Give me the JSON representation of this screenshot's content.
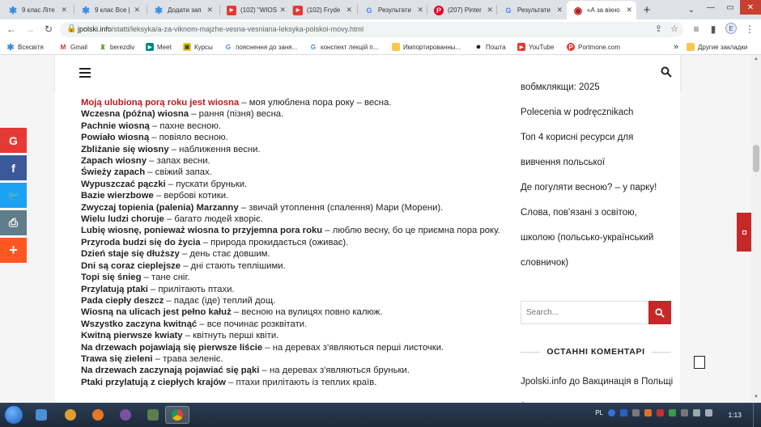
{
  "tabs": [
    {
      "label": "9 клас Літе",
      "icon": "✱",
      "color": "#3a8de0",
      "active": false
    },
    {
      "label": "9 клас Все |",
      "icon": "✱",
      "color": "#3a8de0",
      "active": false
    },
    {
      "label": "Додати зап",
      "icon": "✱",
      "color": "#3a8de0",
      "active": false
    },
    {
      "label": "(102) \"WIOS",
      "icon": "▶",
      "color": "#e53935",
      "active": false
    },
    {
      "label": "(102) Fryde",
      "icon": "▶",
      "color": "#e53935",
      "active": false
    },
    {
      "label": "Результати",
      "icon": "G",
      "color": "#4285f4",
      "active": false
    },
    {
      "label": "(207) Pinter",
      "icon": "P",
      "color": "#e60023",
      "active": false
    },
    {
      "label": "Результати",
      "icon": "G",
      "color": "#4285f4",
      "active": false
    },
    {
      "label": "«А за вікно",
      "icon": "◉",
      "color": "#b71c1c",
      "active": true
    }
  ],
  "window": {
    "minimize": "—",
    "maximize": "▭",
    "close": "✕",
    "tab_search": "⌄",
    "new_tab": "+"
  },
  "nav": {
    "back": "←",
    "forward": "→",
    "reload": "↻",
    "url_domain": "jpolski.info",
    "url_path": "/statti/leksyka/a-za-viknom-majzhe-vesna-vesniana-leksyka-polskoi-movy.html",
    "profile_letter": "E"
  },
  "bookmarks": [
    {
      "label": "Всесвітя",
      "icon": "✱",
      "color": "#3a8de0"
    },
    {
      "label": "Gmail",
      "icon": "M",
      "color": "#d93025"
    },
    {
      "label": "berezdiv",
      "icon": "♜",
      "color": "#689f38"
    },
    {
      "label": "Meet",
      "icon": "▶",
      "color": "#00897b"
    },
    {
      "label": "Курсы",
      "icon": "▣",
      "color": "#fbc02d"
    },
    {
      "label": "пояснення до заня...",
      "icon": "G",
      "color": "#4285f4"
    },
    {
      "label": "конспект лекцій п...",
      "icon": "G",
      "color": "#4285f4"
    },
    {
      "label": "Импортированны...",
      "icon": "▬",
      "color": "#f9a825"
    },
    {
      "label": "Пошта",
      "icon": "●",
      "color": "#222"
    },
    {
      "label": "YouTube",
      "icon": "▶",
      "color": "#e53935"
    },
    {
      "label": "Portmone.com",
      "icon": "P",
      "color": "#e53935"
    }
  ],
  "bookmarks_more": "»",
  "other_bookmarks": "Другие закладки",
  "article": [
    {
      "pl": "Moją ulubioną porą roku jest wiosna",
      "ua": " – моя улюблена пора року – весна.",
      "red": true
    },
    {
      "pl": "Wczesna (późna) wiosna",
      "ua": " – рання (пізня) весна."
    },
    {
      "pl": "Pachnie wiosną",
      "ua": " – пахне весною."
    },
    {
      "pl": "Powiało wiosną",
      "ua": " – повіяло весною."
    },
    {
      "pl": "Zbliżanie się wiosny",
      "ua": " – наближення весни."
    },
    {
      "pl": "Zapach wiosny",
      "ua": " – запах весни."
    },
    {
      "pl": "Świeży zapach",
      "ua": " – свіжий запах."
    },
    {
      "pl": "Wypuszczać pączki",
      "ua": " – пускати бруньки."
    },
    {
      "pl": "Bazie wierzbowe",
      "ua": " – вербові котики."
    },
    {
      "pl": "Zwyczaj topienia (palenia) Marzanny",
      "ua": " – звичай утоплення (спалення) Мари (Морени)."
    },
    {
      "pl": "Wielu ludzi choruje",
      "ua": " – багато людей хворіє."
    },
    {
      "pl": "Lubię wiosnę, ponieważ wiosna to przyjemna pora roku",
      "ua": " – люблю весну, бо це приємна пора року."
    },
    {
      "pl": "Przyroda budzi się do życia",
      "ua": " – природа прокидається (оживає)."
    },
    {
      "pl": "Dzień staje się dłuższy",
      "ua": " – день стає довшим."
    },
    {
      "pl": "Dni są coraz cieplejsze",
      "ua": " – дні стають теплішими."
    },
    {
      "pl": "Topi się śnieg",
      "ua": " – тане сніг."
    },
    {
      "pl": "Przylatują ptaki",
      "ua": " – прилітають птахи."
    },
    {
      "pl": "Pada ciepły deszcz",
      "ua": " – падає (іде) теплий дощ."
    },
    {
      "pl": "Wiosną na ulicach jest pełno kałuż",
      "ua": " – весною на вулицях повно калюж."
    },
    {
      "pl": "Wszystko zaczyna kwitnąć",
      "ua": " – все починає розквітати."
    },
    {
      "pl": "Kwitną pierwsze kwiaty",
      "ua": " – квітнуть перші квіти."
    },
    {
      "pl": "Na drzewach pojawiają się pierwsze liście",
      "ua": " – на деревах з'являються перші листочки."
    },
    {
      "pl": "Trawa się zieleni",
      "ua": " – трава зеленіє."
    },
    {
      "pl": "Na drzewach zaczynają pojawiać się pąki",
      "ua": " – на деревах з'являються бруньки."
    },
    {
      "pl": "Ptaki przylatują z ciepłych krajów",
      "ua": " – птахи прилітають із теплих країв."
    }
  ],
  "sidebar": {
    "cut_top": "вобмклякщи: 2025",
    "links": [
      "Polecenia w podręcznikach",
      "Топ 4 корисні ресурси для вивчення польської",
      "Де погуляти весною? – у парку!",
      "Слова, пов'язані з освітою, школою (польсько-український словничок)"
    ],
    "search_placeholder": "Search...",
    "comments_title": "ОСТАННІ КОМЕНТАРІ",
    "comments": [
      "Jpolski.info до Вакцинація в Польщі (календар щеплень"
    ]
  },
  "share": [
    {
      "label": "G",
      "color": "#e53935",
      "name": "google-share-icon"
    },
    {
      "label": "f",
      "color": "#3b5998",
      "name": "facebook-share-icon"
    },
    {
      "label": "🐦",
      "color": "#1da1f2",
      "name": "twitter-share-icon"
    },
    {
      "label": "⎙",
      "color": "#607d8b",
      "name": "print-share-icon"
    },
    {
      "label": "+",
      "color": "#ff5722",
      "name": "more-share-icon"
    }
  ],
  "taskbar": {
    "lang": "PL",
    "time": "1:13"
  }
}
